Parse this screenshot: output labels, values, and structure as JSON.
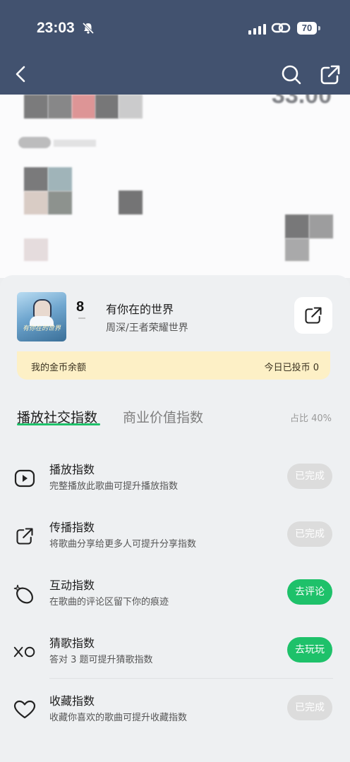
{
  "status_bar": {
    "time": "23:03",
    "battery": "70",
    "icons": [
      "bell-off-icon",
      "signal-icon",
      "link-icon",
      "battery-icon"
    ]
  },
  "nav": {
    "back_icon": "chevron-left-icon",
    "search_icon": "search-icon",
    "share_icon": "share-icon"
  },
  "background": {
    "number_fragment": "33.00"
  },
  "song": {
    "rank": "8",
    "title": "有你在的世界",
    "artist": "周深/王者荣耀世界",
    "cover_text": "有你在的世界"
  },
  "coin": {
    "balance_label": "我的金币余额",
    "today_label": "今日已投币 0"
  },
  "tabs": [
    {
      "label": "播放社交指数",
      "active": true
    },
    {
      "label": "商业价值指数",
      "active": false
    }
  ],
  "ratio_label": "占比 40%",
  "tasks": [
    {
      "title": "播放指数",
      "desc": "完整播放此歌曲可提升播放指数",
      "button": "已完成",
      "icon": "play-icon",
      "state": "done"
    },
    {
      "title": "传播指数",
      "desc": "将歌曲分享给更多人可提升分享指数",
      "button": "已完成",
      "icon": "share-icon",
      "state": "done"
    },
    {
      "title": "互动指数",
      "desc": "在歌曲的评论区留下你的痕迹",
      "button": "去评论",
      "icon": "comment-icon",
      "state": "go"
    },
    {
      "title": "猜歌指数",
      "desc": "答对 3 题可提升猜歌指数",
      "button": "去玩玩",
      "icon": "tic-tac-toe-icon",
      "state": "go"
    },
    {
      "title": "收藏指数",
      "desc": "收藏你喜欢的歌曲可提升收藏指数",
      "button": "已完成",
      "icon": "heart-icon",
      "state": "done"
    }
  ],
  "colors": {
    "accent": "#1ec16a",
    "header": "#42526f",
    "coin_bar": "#fdf0c6",
    "done_button": "#dcdcdc"
  }
}
